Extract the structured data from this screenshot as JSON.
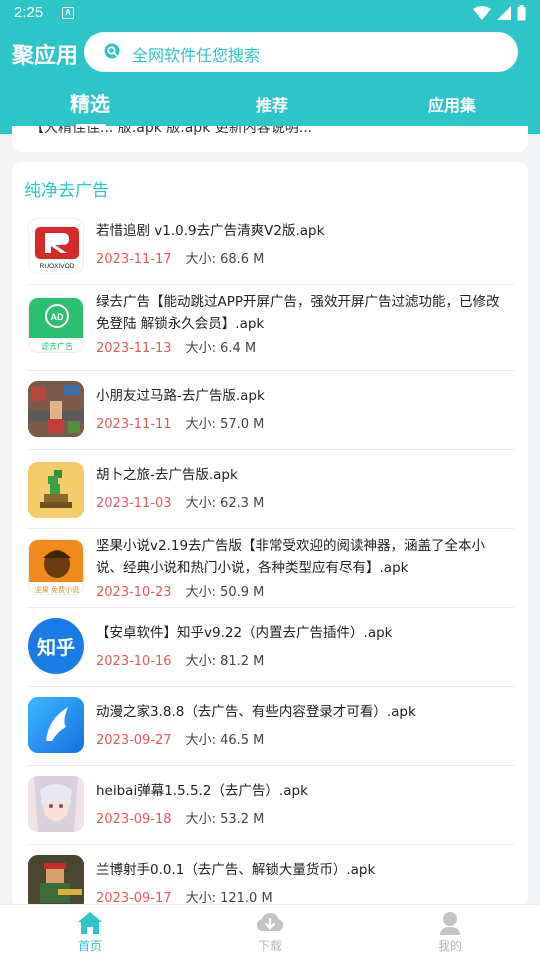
{
  "status_bar": {
    "time": "2:25",
    "notification_glyph": "A"
  },
  "header": {
    "brand": "聚应用",
    "search_placeholder": "全网软件任您搜索",
    "tabs": [
      {
        "label": "精选",
        "active": true
      },
      {
        "label": "推荐",
        "active": false
      },
      {
        "label": "应用集",
        "active": false
      }
    ]
  },
  "top_card": {
    "partial_text": "【大精佳佳...     版.apk     版.apk       更新内容说明..."
  },
  "section": {
    "title": "纯净去广告",
    "size_label": "大小:",
    "items": [
      {
        "title": "若惜追剧 v1.0.9去广告清爽V2版.apk",
        "date": "2023-11-17",
        "size": "68.6 M",
        "icon": "ruoxi-app-icon"
      },
      {
        "title": "绿去广告【能动跳过APP开屏广告，强效开屏广告过滤功能，已修改免登陆 解锁永久会员】.apk",
        "date": "2023-11-13",
        "size": "6.4 M",
        "icon": "ad-skip-app-icon"
      },
      {
        "title": "小朋友过马路-去广告版.apk",
        "date": "2023-11-11",
        "size": "57.0 M",
        "icon": "crossing-game-icon"
      },
      {
        "title": "胡卜之旅-去广告版.apk",
        "date": "2023-11-03",
        "size": "62.3 M",
        "icon": "carrot-game-icon"
      },
      {
        "title": "坚果小说v2.19去广告版【非常受欢迎的阅读神器，涵盖了全本小说、经典小说和热门小说，各种类型应有尽有】.apk",
        "date": "2023-10-23",
        "size": "50.9 M",
        "icon": "nut-novel-icon"
      },
      {
        "title": "【安卓软件】知乎v9.22（内置去广告插件）.apk",
        "date": "2023-10-16",
        "size": "81.2 M",
        "icon": "zhihu-icon"
      },
      {
        "title": "动漫之家3.8.8（去广告、有些内容登录才可看）.apk",
        "date": "2023-09-27",
        "size": "46.5 M",
        "icon": "anime-home-icon"
      },
      {
        "title": "heibai弹幕1.5.5.2（去广告）.apk",
        "date": "2023-09-18",
        "size": "53.2 M",
        "icon": "heibai-danmaku-icon"
      },
      {
        "title": "兰博射手0.0.1（去广告、解锁大量货币）.apk",
        "date": "2023-09-17",
        "size": "121.0 M",
        "icon": "rambo-shooter-icon"
      }
    ]
  },
  "ruoxi_logo_text": "RUOXIVOD",
  "ad_icon": {
    "badge": "AD",
    "caption": "滤去广告"
  },
  "nut_icon": {
    "caption": "坚果 免费小说"
  },
  "zhihu_icon_text": "知乎",
  "bottom_nav": [
    {
      "label": "首页",
      "active": true
    },
    {
      "label": "下载",
      "active": false
    },
    {
      "label": "我的",
      "active": false
    }
  ],
  "colors": {
    "accent": "#2ec5c9",
    "date": "#e05a5a",
    "inactive": "#b8b8b8"
  }
}
